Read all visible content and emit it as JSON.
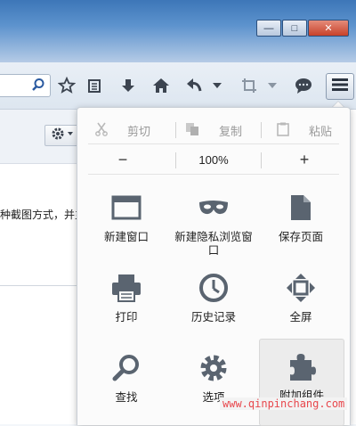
{
  "window": {
    "controls": {
      "minimize": "—",
      "maximize": "□",
      "close": "✕"
    }
  },
  "toolbar": {
    "icons": [
      "search-icon",
      "star-icon",
      "reader-icon",
      "download-icon",
      "home-icon",
      "back-icon",
      "dropdown-arrow-icon",
      "crop-icon",
      "dropdown-arrow-icon",
      "chat-icon",
      "menu-icon"
    ]
  },
  "page": {
    "text": "种截图方式，并主"
  },
  "menu": {
    "edit": {
      "cut": "剪切",
      "copy": "复制",
      "paste": "粘贴"
    },
    "zoom": {
      "minus": "−",
      "value": "100%",
      "plus": "+"
    },
    "items": [
      {
        "label": "新建窗口",
        "icon": "window-icon"
      },
      {
        "label": "新建隐私浏览窗口",
        "icon": "mask-icon"
      },
      {
        "label": "保存页面",
        "icon": "page-icon"
      },
      {
        "label": "打印",
        "icon": "printer-icon"
      },
      {
        "label": "历史记录",
        "icon": "clock-icon"
      },
      {
        "label": "全屏",
        "icon": "fullscreen-icon"
      },
      {
        "label": "查找",
        "icon": "magnifier-icon"
      },
      {
        "label": "选项",
        "icon": "gear-icon"
      },
      {
        "label": "附加组件",
        "icon": "puzzle-icon"
      }
    ]
  },
  "watermark": "www.qinpinchang.com",
  "colors": {
    "accent": "#3d76b8",
    "icon": "#5a6470",
    "close": "#c7412a",
    "watermark": "#e8474c"
  }
}
